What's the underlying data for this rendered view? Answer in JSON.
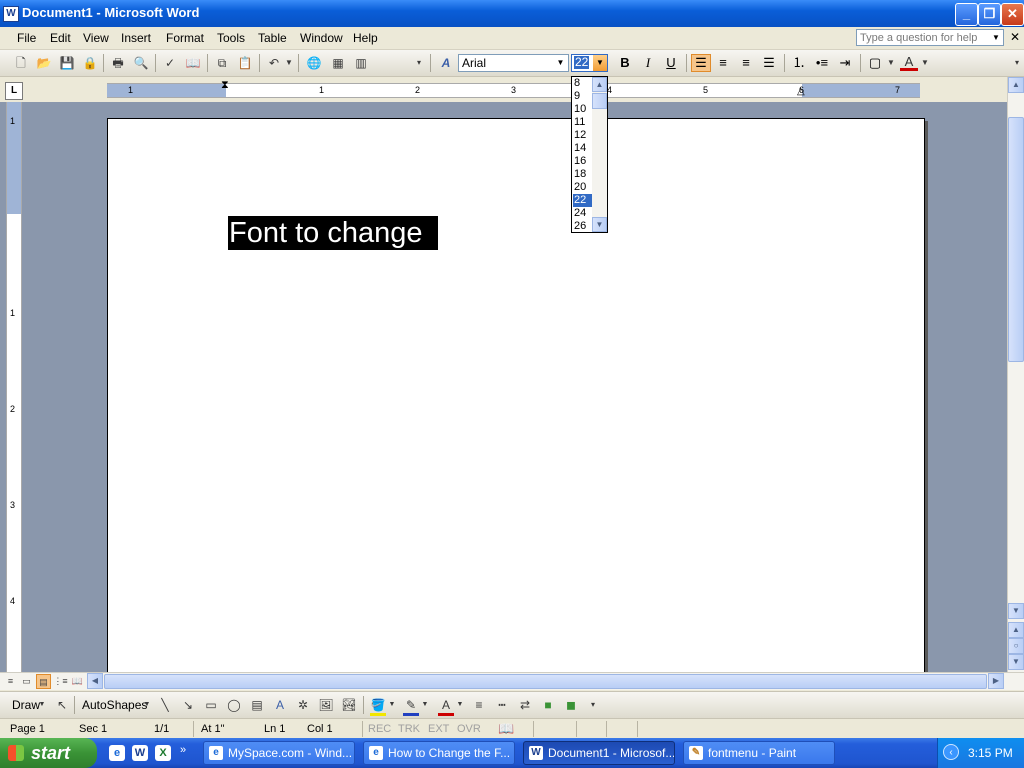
{
  "window": {
    "title": "Document1 - Microsoft Word",
    "app_icon": "word-icon",
    "minimize": "_",
    "restore": "❐",
    "close": "✕"
  },
  "menu": {
    "items": [
      "File",
      "Edit",
      "View",
      "Insert",
      "Format",
      "Tools",
      "Table",
      "Window",
      "Help"
    ],
    "help_placeholder": "Type a question for help",
    "doc_close": "✕"
  },
  "toolbar": {
    "font_name": "Arial",
    "font_size": "22",
    "bold": "B",
    "italic": "I",
    "underline": "U",
    "font_color": "#cc0000"
  },
  "font_size_list": {
    "options": [
      "8",
      "9",
      "10",
      "11",
      "12",
      "14",
      "16",
      "18",
      "20",
      "22",
      "24",
      "26"
    ],
    "selected": "22"
  },
  "ruler": {
    "numbers": [
      "1",
      "1",
      "2",
      "3",
      "4",
      "5",
      "6",
      "7"
    ]
  },
  "vruler": {
    "numbers": [
      "1",
      "1",
      "2",
      "3",
      "4"
    ]
  },
  "document": {
    "selected_text": "Font to change"
  },
  "drawbar": {
    "draw_label": "Draw",
    "autoshapes_label": "AutoShapes"
  },
  "statusbar": {
    "page": "Page 1",
    "sec": "Sec 1",
    "pages": "1/1",
    "at": "At 1\"",
    "ln": "Ln 1",
    "col": "Col 1",
    "rec": "REC",
    "trk": "TRK",
    "ext": "EXT",
    "ovr": "OVR"
  },
  "taskbar": {
    "start": "start",
    "tasks": [
      {
        "label": "MySpace.com - Wind...",
        "icon": "ie-icon"
      },
      {
        "label": "How to Change the F...",
        "icon": "ie-icon"
      },
      {
        "label": "Document1 - Microsof...",
        "icon": "word-icon"
      },
      {
        "label": "fontmenu - Paint",
        "icon": "paint-icon"
      }
    ],
    "clock": "3:15 PM"
  }
}
